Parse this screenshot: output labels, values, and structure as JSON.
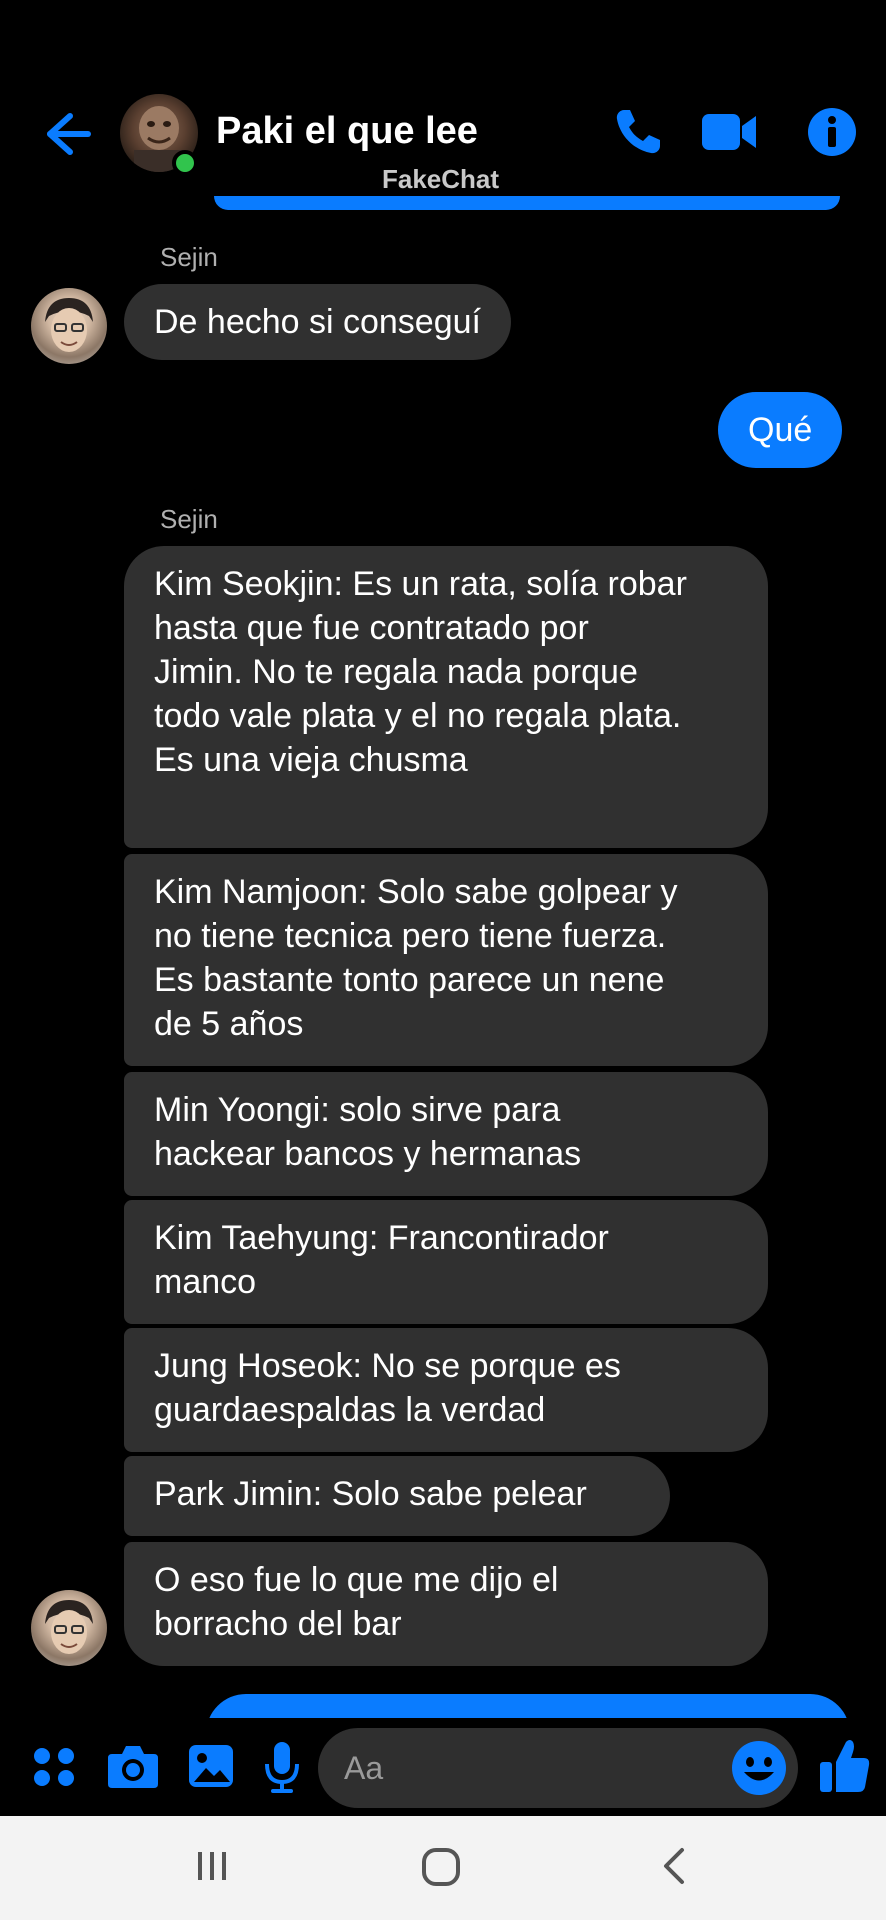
{
  "header": {
    "contact_name": "Paki el que lee",
    "watermark": "FakeChat",
    "back_icon": "arrow-left-icon",
    "call_icon": "phone-icon",
    "video_icon": "video-camera-icon",
    "info_icon": "info-icon",
    "online_status_color": "#31c44d"
  },
  "colors": {
    "accent": "#0a7cff",
    "incoming_bubble": "#303030",
    "background": "#000000"
  },
  "messages": {
    "sender_1": "Sejin",
    "msg_1": "De hecho si conseguí",
    "out_1": "Qué",
    "sender_2": "Sejin",
    "msg_2": "Kim Seokjin: Es un rata, solía robar\nhasta que fue contratado por\nJimin. No te regala nada porque\ntodo vale plata y el no regala plata.\nEs una vieja chusma",
    "msg_3": "Kim Namjoon: Solo sabe golpear y\nno tiene tecnica pero tiene fuerza.\nEs bastante tonto parece un nene\nde 5 años",
    "msg_4": "Min Yoongi: solo sirve para\nhackear bancos y hermanas",
    "msg_5": "Kim Taehyung: Francontirador\nmanco",
    "msg_6": "Jung Hoseok: No se porque es\nguardaespaldas la verdad",
    "msg_7": "Park Jimin: Solo sabe pelear",
    "msg_8": "O eso fue lo que me dijo el\nborracho del bar"
  },
  "composer": {
    "placeholder": "Aa",
    "icons": [
      "apps-grid-icon",
      "camera-icon",
      "gallery-icon",
      "microphone-icon",
      "emoji-icon",
      "thumbs-up-icon"
    ]
  },
  "android_nav": {
    "icons": [
      "recent-apps-icon",
      "home-icon",
      "back-icon"
    ]
  }
}
